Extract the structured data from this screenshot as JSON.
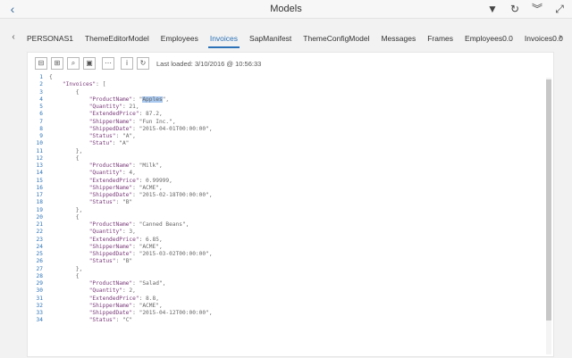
{
  "window": {
    "title": "Models",
    "icons": [
      "filter-icon",
      "refresh-icon",
      "collapse-icon",
      "fullscreen-icon"
    ]
  },
  "tabs": [
    {
      "label": "PERSONAS1",
      "active": false
    },
    {
      "label": "ThemeEditorModel",
      "active": false
    },
    {
      "label": "Employees",
      "active": false
    },
    {
      "label": "Invoices",
      "active": true
    },
    {
      "label": "SapManifest",
      "active": false
    },
    {
      "label": "ThemeConfigModel",
      "active": false
    },
    {
      "label": "Messages",
      "active": false
    },
    {
      "label": "Frames",
      "active": false
    },
    {
      "label": "Employees0.0",
      "active": false
    },
    {
      "label": "Invoices0.0",
      "active": false
    },
    {
      "label": "Sap",
      "active": false
    }
  ],
  "toolbar": {
    "last_loaded": "Last loaded: 3/10/2016 @ 10:56:33"
  },
  "colors": {
    "accent": "#2b72b8",
    "line_numbers": "#2b72b8",
    "selection": "#a8c8ef"
  },
  "code_lines": [
    "{",
    "    \"Invoices\": [",
    "        {",
    "            \"ProductName\": \"Apples\",",
    "            \"Quantity\": 21,",
    "            \"ExtendedPrice\": 87.2,",
    "            \"ShipperName\": \"Fun Inc.\",",
    "            \"ShippedDate\": \"2015-04-01T00:00:00\",",
    "            \"Status\": \"A\",",
    "            \"Statu\": \"A\"",
    "        },",
    "        {",
    "            \"ProductName\": \"Milk\",",
    "            \"Quantity\": 4,",
    "            \"ExtendedPrice\": 0.99999,",
    "            \"ShipperName\": \"ACME\",",
    "            \"ShippedDate\": \"2015-02-18T00:00:00\",",
    "            \"Status\": \"B\"",
    "        },",
    "        {",
    "            \"ProductName\": \"Canned Beans\",",
    "            \"Quantity\": 3,",
    "            \"ExtendedPrice\": 6.85,",
    "            \"ShipperName\": \"ACME\",",
    "            \"ShippedDate\": \"2015-03-02T00:00:00\",",
    "            \"Status\": \"B\"",
    "        },",
    "        {",
    "            \"ProductName\": \"Salad\",",
    "            \"Quantity\": 2,",
    "            \"ExtendedPrice\": 8.8,",
    "            \"ShipperName\": \"ACME\",",
    "            \"ShippedDate\": \"2015-04-12T00:00:00\",",
    "            \"Status\": \"C\""
  ],
  "selected_text": "Apples"
}
